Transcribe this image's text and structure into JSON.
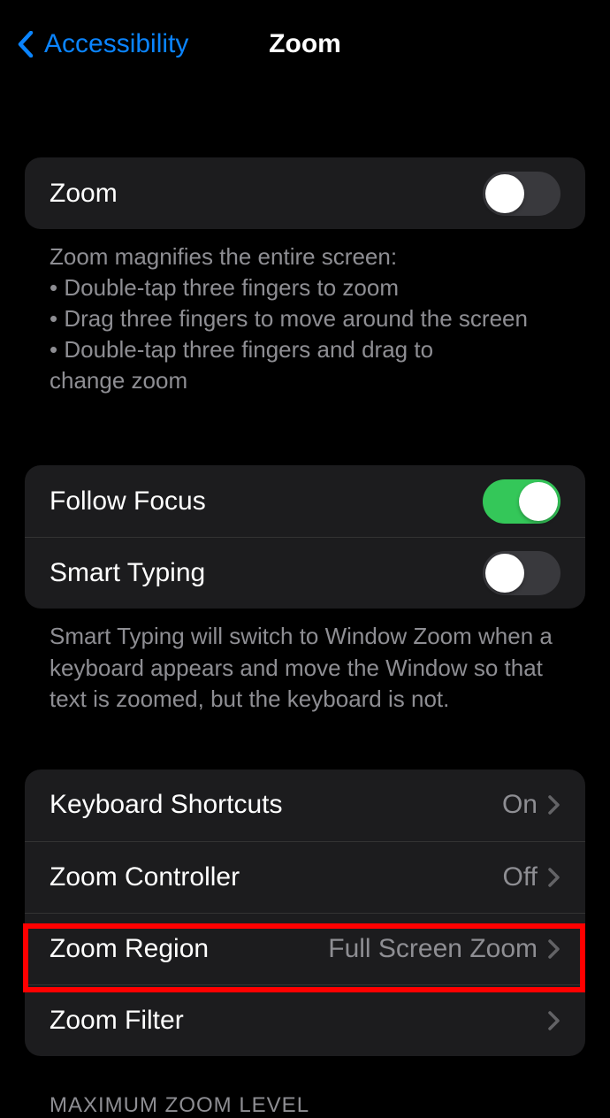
{
  "nav": {
    "back_label": "Accessibility",
    "title": "Zoom"
  },
  "group1": {
    "zoom_label": "Zoom",
    "zoom_on": false
  },
  "group1_footer": {
    "heading": "Zoom magnifies the entire screen:",
    "bullets": [
      "Double-tap three fingers to zoom",
      "Drag three fingers to move around the screen",
      "Double-tap three fingers and drag to"
    ],
    "trailing": "change zoom"
  },
  "group2": {
    "follow_focus_label": "Follow Focus",
    "follow_focus_on": true,
    "smart_typing_label": "Smart Typing",
    "smart_typing_on": false
  },
  "group2_footer": "Smart Typing will switch to Window Zoom when a keyboard appears and move the Window so that text is zoomed, but the keyboard is not.",
  "group3": {
    "rows": [
      {
        "label": "Keyboard Shortcuts",
        "value": "On"
      },
      {
        "label": "Zoom Controller",
        "value": "Off"
      },
      {
        "label": "Zoom Region",
        "value": "Full Screen Zoom"
      },
      {
        "label": "Zoom Filter",
        "value": ""
      }
    ]
  },
  "section_header": "MAXIMUM ZOOM LEVEL"
}
